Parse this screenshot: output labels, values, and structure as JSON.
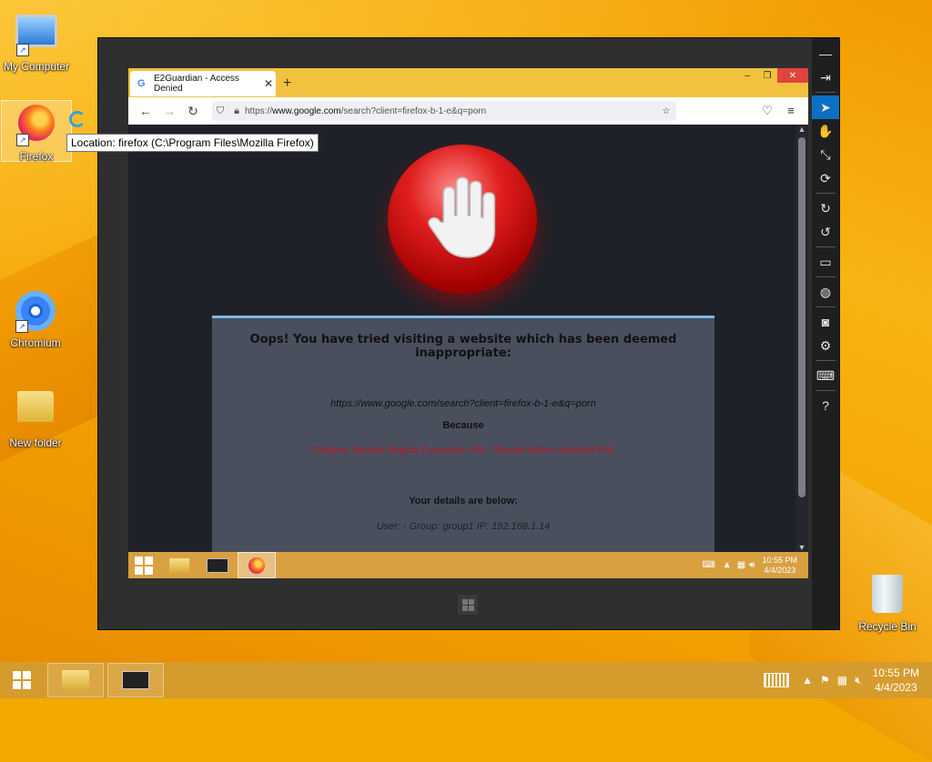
{
  "desktop": {
    "icons": [
      {
        "label": "My Computer"
      },
      {
        "label": "Firefox"
      },
      {
        "label": "Chromium"
      },
      {
        "label": "New folder"
      },
      {
        "label": "Recycle Bin"
      }
    ],
    "tooltip": "Location: firefox (C:\\Program Files\\Mozilla Firefox)"
  },
  "vm_sidebar": {
    "buttons": [
      "minimize",
      "pin",
      "pointer",
      "hand",
      "resize",
      "mouse",
      "refresh",
      "undo",
      "display",
      "globe",
      "camera",
      "settings",
      "keyboard",
      "help"
    ],
    "glyphs": [
      "—",
      "⇥",
      "➤",
      "✋",
      "⤡",
      "⟳",
      "↻",
      "↺",
      "▭",
      "◍",
      "◙",
      "⚙",
      "⌨",
      "?"
    ]
  },
  "browser": {
    "tab_title": "E2Guardian - Access Denied",
    "new_tab": "+",
    "url_host": "www.google.com",
    "url_prefix": "https://",
    "url_path": "/search?client=firefox-b-1-e&q=porn"
  },
  "block_page": {
    "heading": "Oops! You have tried visiting a website which has been deemed inappropriate:",
    "blocked_url": "https://www.google.com/search?client=firefox-b-1-e&q=porn",
    "because": "Because",
    "category": "Category: Banned Regular Expression URL : Banned pattern matched URL",
    "details_heading": "Your details are below:",
    "user_line": "User: -   Group: group1   IP: 192.168.1.14"
  },
  "inner_taskbar": {
    "time": "10:55 PM",
    "date": "4/4/2023"
  },
  "taskbar": {
    "time": "10:55 PM",
    "date": "4/4/2023"
  },
  "colors": {
    "wallpaper": "#f2a900",
    "taskbar": "#d69b2d",
    "vm_frame": "#2f2f2f",
    "stop_sign": "#e01e1e",
    "panel": "#4a4f5e",
    "category_text": "#c0121c"
  }
}
